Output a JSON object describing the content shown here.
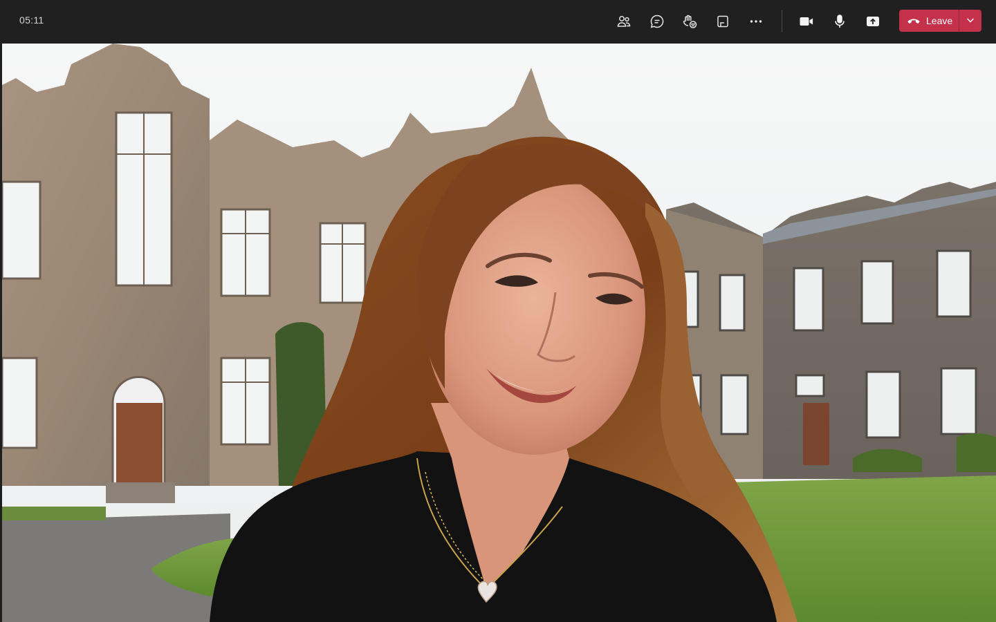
{
  "call": {
    "timer": "05:11"
  },
  "toolbar": {
    "buttons": [
      {
        "name": "people-icon"
      },
      {
        "name": "chat-icon"
      },
      {
        "name": "reactions-icon"
      },
      {
        "name": "view-icon"
      },
      {
        "name": "more-options-icon"
      },
      {
        "name": "camera-icon"
      },
      {
        "name": "microphone-icon"
      },
      {
        "name": "share-screen-icon"
      }
    ],
    "leave_label": "Leave"
  },
  "colors": {
    "toolbar_bg": "#202020",
    "leave_red": "#c4314b",
    "icon": "#e6e6e6"
  }
}
